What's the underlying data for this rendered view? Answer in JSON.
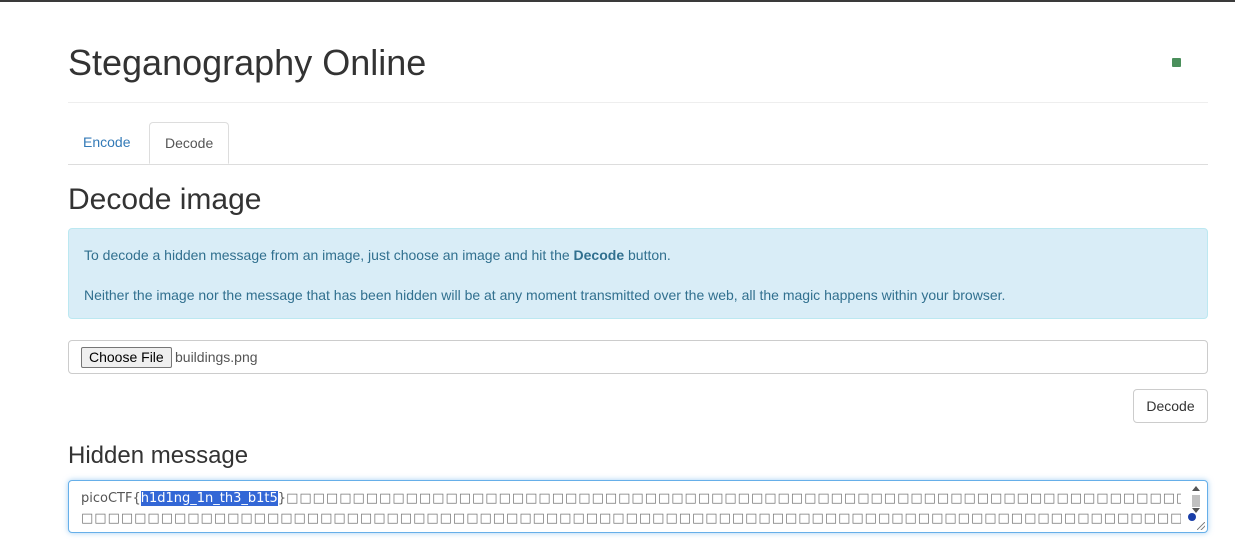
{
  "header": {
    "title": "Steganography Online",
    "status_color": "#4a8f5b"
  },
  "tabs": [
    {
      "label": "Encode",
      "active": false
    },
    {
      "label": "Decode",
      "active": true
    }
  ],
  "decode": {
    "title": "Decode image",
    "info_line1_prefix": "To decode a hidden message from an image, just choose an image and hit the ",
    "info_line1_bold": "Decode",
    "info_line1_suffix": " button.",
    "info_line2": "Neither the image nor the message that has been hidden will be at any moment transmitted over the web, all the magic happens within your browser.",
    "choose_file_label": "Choose File",
    "file_name": "buildings.png",
    "decode_button_label": "Decode"
  },
  "hidden_message": {
    "title": "Hidden message",
    "prefix": "picoCTF{",
    "selected": "h1d1ng_1n_th3_b1t5",
    "suffix": "}",
    "boxes_line1": "□□□□□□□□□□□□□□□□□□□□□□□□□□□□□□□□□□□□□□□□□□□□□□□□□□□□□□□□□□□□□□□□□□□□□□□□□□□□□",
    "boxes_line2": "□□□□□□□□□□□□□□□□□□□□□□□□□□□□□□□□□□□□□□□□□□□□□□□□□□□□□□□□□□□□□□□□□□□□□□□□□□□□□□□□□□□□□□□□□□□□□□□"
  }
}
